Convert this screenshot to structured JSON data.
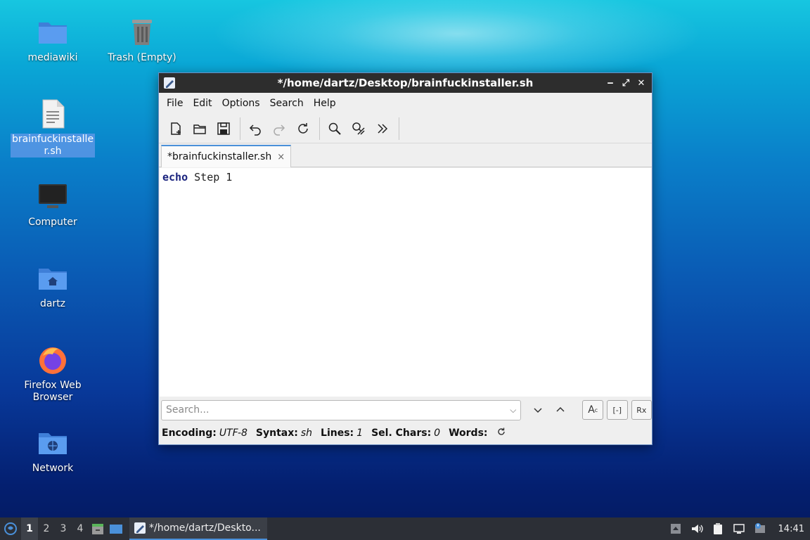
{
  "desktop": {
    "icons": [
      {
        "label": "mediawiki"
      },
      {
        "label": "Trash (Empty)"
      },
      {
        "label": "brainfuckinstalle\nr.sh"
      },
      {
        "label": "Computer"
      },
      {
        "label": "dartz"
      },
      {
        "label": "Firefox Web\nBrowser"
      },
      {
        "label": "Network"
      }
    ]
  },
  "window": {
    "title": "*/home/dartz/Desktop/brainfuckinstaller.sh",
    "controls": {
      "minimize": "‒",
      "maximize": "⤢",
      "close": "✕"
    },
    "menu": [
      "File",
      "Edit",
      "Options",
      "Search",
      "Help"
    ],
    "toolbar": [
      "new-file-icon",
      "open-folder-icon",
      "save-icon",
      "undo-icon",
      "redo-icon",
      "reload-icon",
      "find-icon",
      "find-replace-icon",
      "more-icon"
    ],
    "tab": {
      "label": "*brainfuckinstaller.sh",
      "close": "×"
    },
    "editor": {
      "keyword": "echo",
      "rest": " Step 1"
    },
    "search": {
      "placeholder": "Search...",
      "option_labels": [
        "A",
        "[-]",
        "Rx"
      ]
    },
    "status": {
      "encoding_label": "Encoding:",
      "encoding_value": "UTF-8",
      "syntax_label": "Syntax:",
      "syntax_value": "sh",
      "lines_label": "Lines:",
      "lines_value": "1",
      "selchars_label": "Sel. Chars:",
      "selchars_value": "0",
      "words_label": "Words:"
    }
  },
  "taskbar": {
    "workspaces": [
      "1",
      "2",
      "3",
      "4"
    ],
    "active_workspace": "1",
    "task_label": "*/home/dartz/Deskto...",
    "clock": "14:41"
  },
  "colors": {
    "accent": "#4a90d9",
    "titlebar": "#2d2d2d",
    "taskbar": "#2c2f36"
  }
}
